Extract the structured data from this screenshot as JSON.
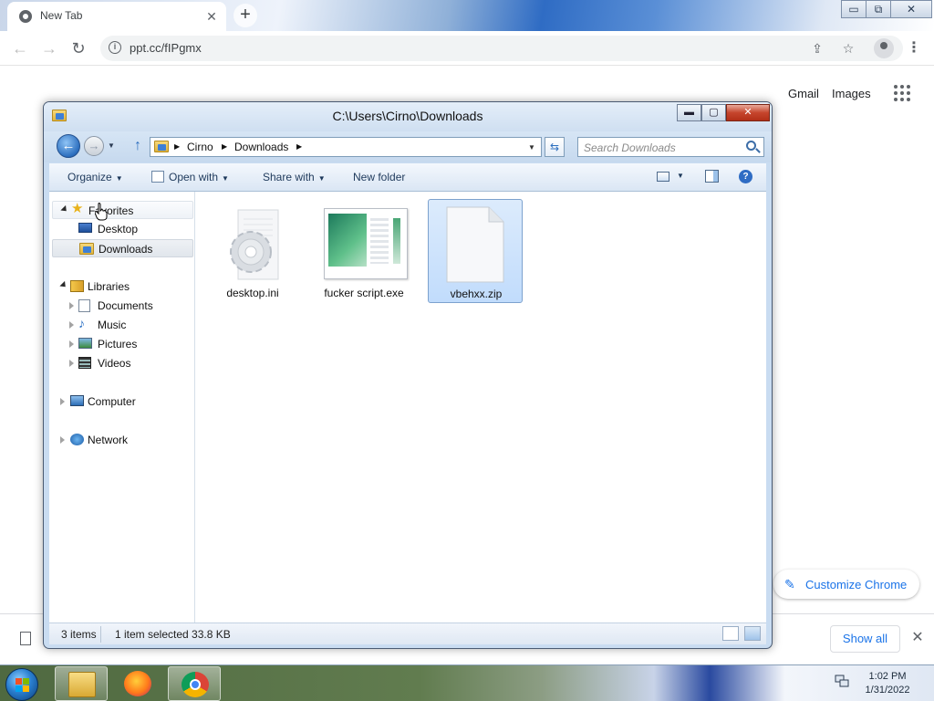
{
  "browser": {
    "tab_title": "New Tab",
    "tab_close": "✕",
    "new_tab": "+",
    "url": "ppt.cc/fIPgmx",
    "links": [
      "Gmail",
      "Images"
    ],
    "customize_label": "Customize Chrome",
    "show_all_label": "Show all",
    "window_controls": {
      "min": "▭",
      "max": "⧉",
      "close": "✕"
    }
  },
  "explorer": {
    "title": "C:\\Users\\Cirno\\Downloads",
    "breadcrumb": [
      "Cirno",
      "Downloads"
    ],
    "search_placeholder": "Search Downloads",
    "commands": [
      "Organize",
      "Open with",
      "Share with",
      "New folder"
    ],
    "nav": {
      "favorites": "Favorites",
      "desktop": "Desktop",
      "downloads": "Downloads",
      "libraries": "Libraries",
      "documents": "Documents",
      "music": "Music",
      "pictures": "Pictures",
      "videos": "Videos",
      "computer": "Computer",
      "network": "Network"
    },
    "files": [
      {
        "name": "desktop.ini",
        "icon": "settings-file-icon",
        "selected": false
      },
      {
        "name": "fucker script.exe",
        "icon": "executable-icon",
        "selected": false
      },
      {
        "name": "vbehxx.zip",
        "icon": "blank-file-icon",
        "selected": true
      }
    ],
    "status": {
      "count": "3 items",
      "selection": "1 item selected  33.8 KB"
    }
  },
  "taskbar": {
    "time": "1:02 PM",
    "date": "1/31/2022"
  },
  "colors": {
    "link_blue": "#1a73e8",
    "selection": "#c1dcfc"
  }
}
